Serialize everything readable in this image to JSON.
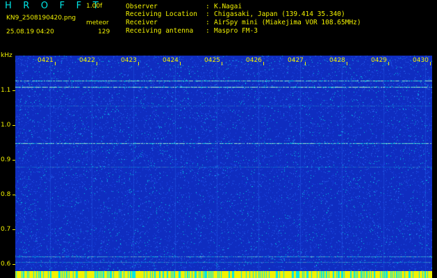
{
  "header": {
    "app_title": "H R O F F T",
    "version": "1.00f",
    "filename": "KN9_2508190420.png",
    "mode": "meteor",
    "datetime": "25.08.19 04:20",
    "count": "129",
    "info": [
      {
        "label": "Observer",
        "value": "K.Nagai"
      },
      {
        "label": "Receiving Location",
        "value": "Chigasaki, Japan (139.414 35.340)"
      },
      {
        "label": "Receiver",
        "value": "AirSpy mini (Miakejima VOR 108.65MHz)"
      },
      {
        "label": "Receiving antenna",
        "value": "Maspro FM-3"
      }
    ]
  },
  "chart_data": {
    "type": "heatmap",
    "xlabel": "",
    "ylabel": "kHz",
    "x_ticks": [
      "0421",
      "0422",
      "0423",
      "0424",
      "0425",
      "0426",
      "0427",
      "0428",
      "0429",
      "0430"
    ],
    "y_ticks": [
      "1.1",
      "1.0",
      "0.9",
      "0.8",
      "0.7",
      "0.6"
    ],
    "ylim": [
      0.58,
      1.2
    ],
    "colors": {
      "background": "#0f2dc0",
      "noise_low": "#1c48e8",
      "noise_mid": "#2a6ef5",
      "noise_high": "#00d9e8",
      "signal": "#a8ffd0",
      "tick": "#f2f200",
      "bottom_strip_a": "#f2f200",
      "bottom_strip_b": "#00e6e6"
    }
  }
}
